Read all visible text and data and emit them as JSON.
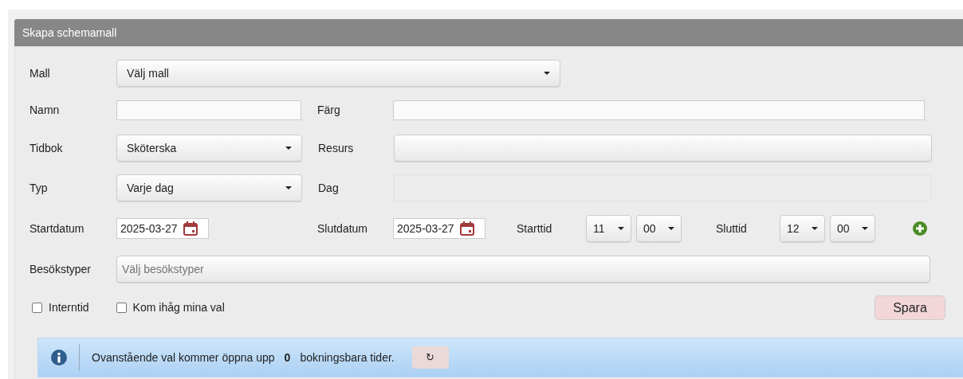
{
  "panel": {
    "title": "Skapa schemamall"
  },
  "mall": {
    "label": "Mall",
    "value": "Välj mall"
  },
  "namn": {
    "label": "Namn"
  },
  "farg": {
    "label": "Färg"
  },
  "tidbok": {
    "label": "Tidbok",
    "value": "Sköterska"
  },
  "resurs": {
    "label": "Resurs"
  },
  "typ": {
    "label": "Typ",
    "value": "Varje dag"
  },
  "dag": {
    "label": "Dag",
    "disabled": true
  },
  "startdatum": {
    "label": "Startdatum",
    "value": "2025-03-27"
  },
  "slutdatum": {
    "label": "Slutdatum",
    "value": "2025-03-27"
  },
  "starttid": {
    "label": "Starttid",
    "hour": "11",
    "minute": "00"
  },
  "sluttid": {
    "label": "Sluttid",
    "hour": "12",
    "minute": "00"
  },
  "besokstyper": {
    "label": "Besökstyper",
    "placeholder": "Välj besökstyper"
  },
  "checkboxes": [
    {
      "label": "Interntid",
      "checked": false
    },
    {
      "label": "Kom ihåg mina val",
      "checked": false
    }
  ],
  "save_button": "Spara",
  "info": {
    "text_before": "Ovanstående val kommer öppna upp",
    "count": "0",
    "text_after": "bokningsbara tider.",
    "refresh": "↻"
  }
}
